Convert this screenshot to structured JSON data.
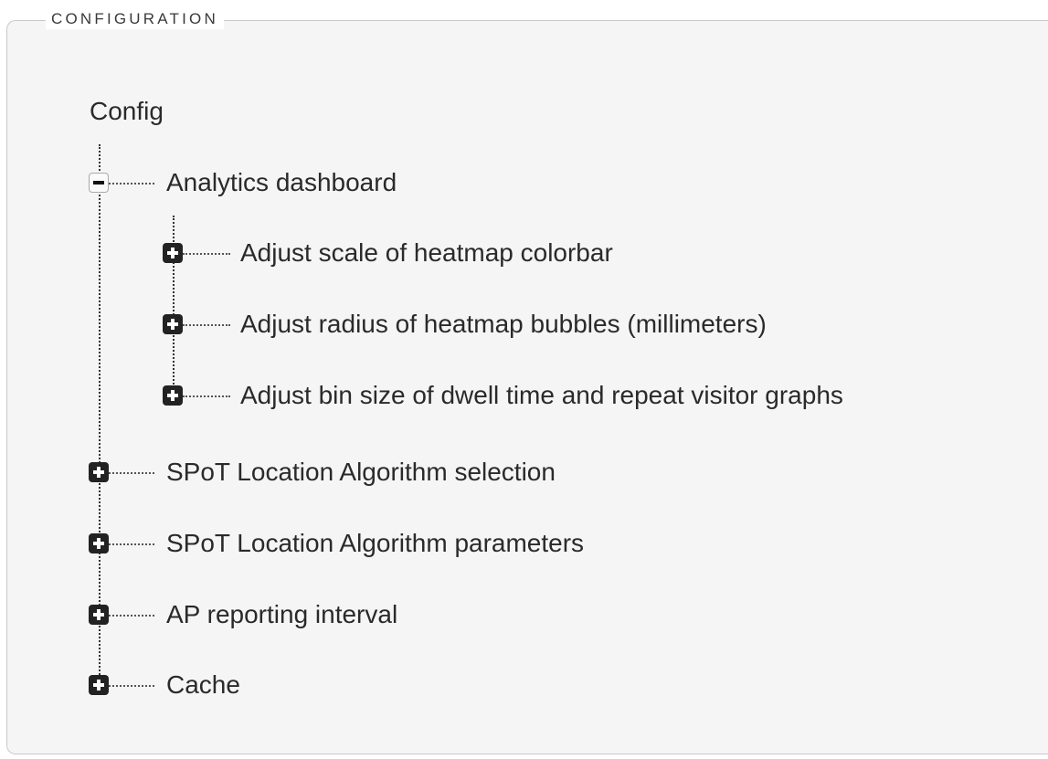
{
  "panel": {
    "legend": "CONFIGURATION"
  },
  "tree": {
    "root_label": "Config",
    "nodes": [
      {
        "label": "Analytics dashboard",
        "state": "expanded",
        "children": [
          {
            "label": "Adjust scale of heatmap colorbar",
            "state": "collapsed"
          },
          {
            "label": "Adjust radius of heatmap bubbles (millimeters)",
            "state": "collapsed"
          },
          {
            "label": "Adjust bin size of dwell time and repeat visitor graphs",
            "state": "collapsed"
          }
        ]
      },
      {
        "label": "SPoT Location Algorithm selection",
        "state": "collapsed"
      },
      {
        "label": "SPoT Location Algorithm parameters",
        "state": "collapsed"
      },
      {
        "label": "AP reporting interval",
        "state": "collapsed"
      },
      {
        "label": "Cache",
        "state": "collapsed"
      }
    ]
  },
  "icons": {
    "expanded": "minus-square-icon",
    "collapsed": "plus-square-icon"
  }
}
